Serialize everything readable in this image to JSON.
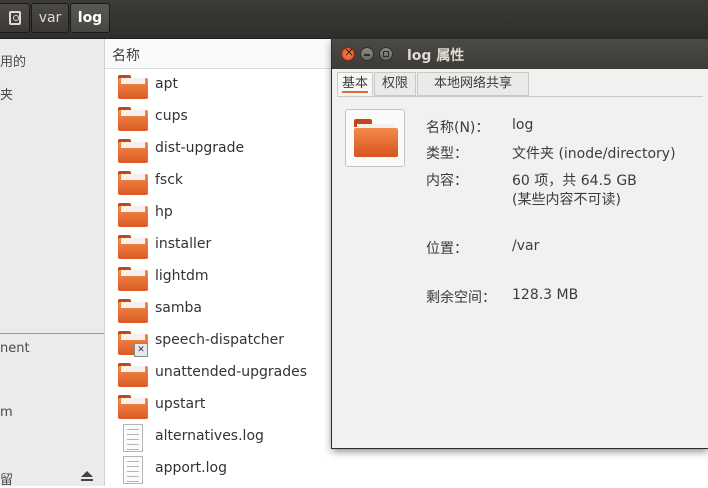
{
  "pathbar": {
    "crumbs": [
      {
        "label": "",
        "icon": "disk-icon"
      },
      {
        "label": "var"
      },
      {
        "label": "log"
      }
    ]
  },
  "sidebar": {
    "items": [
      {
        "label": "用的"
      },
      {
        "label": "夹"
      },
      {
        "label": "nent"
      },
      {
        "label": "m"
      },
      {
        "label": "留"
      }
    ]
  },
  "filelist": {
    "column_header": "名称",
    "rows": [
      {
        "name": "apt",
        "type": "folder"
      },
      {
        "name": "cups",
        "type": "folder"
      },
      {
        "name": "dist-upgrade",
        "type": "folder"
      },
      {
        "name": "fsck",
        "type": "folder"
      },
      {
        "name": "hp",
        "type": "folder"
      },
      {
        "name": "installer",
        "type": "folder"
      },
      {
        "name": "lightdm",
        "type": "folder"
      },
      {
        "name": "samba",
        "type": "folder"
      },
      {
        "name": "speech-dispatcher",
        "type": "folder-locked"
      },
      {
        "name": "unattended-upgrades",
        "type": "folder"
      },
      {
        "name": "upstart",
        "type": "folder"
      },
      {
        "name": "alternatives.log",
        "type": "file"
      },
      {
        "name": "apport.log",
        "type": "file"
      }
    ]
  },
  "dialog": {
    "title": "log 属性",
    "tabs": [
      {
        "label": "基本",
        "active": true
      },
      {
        "label": "权限"
      },
      {
        "label": "本地网络共享"
      }
    ],
    "properties": {
      "name_label": "名称(N)：",
      "name_value": "log",
      "type_label": "类型：",
      "type_value": "文件夹 (inode/directory)",
      "contents_label": "内容：",
      "contents_value": "60 项，共 64.5 GB",
      "contents_note": "(某些内容不可读)",
      "location_label": "位置：",
      "location_value": "/var",
      "free_label": "剩余空间：",
      "free_value": "128.3 MB"
    }
  },
  "colors": {
    "titlebar": "#3c3b37",
    "accent": "#e06a35",
    "folder": "#e8733a"
  }
}
